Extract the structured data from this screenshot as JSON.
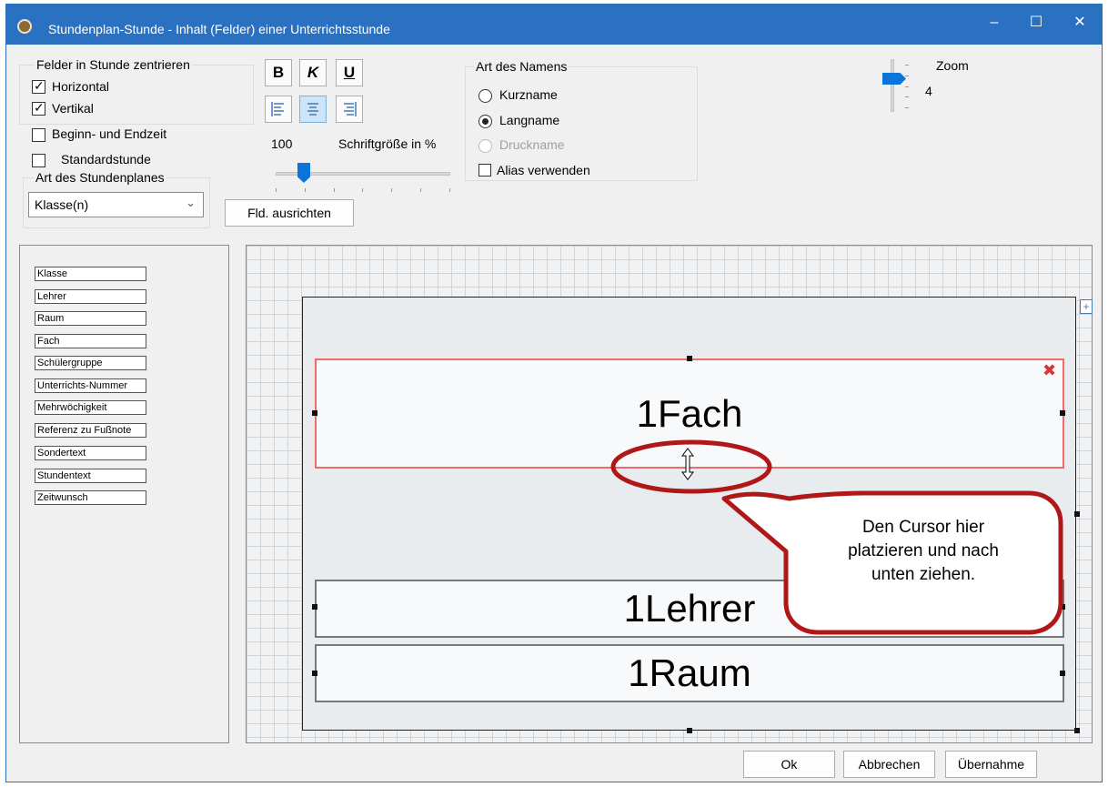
{
  "window": {
    "title": "Stundenplan-Stunde - Inhalt (Felder) einer Unterrichtsstunde",
    "minimize": "‒",
    "maximize": "☐",
    "close": "✕"
  },
  "center_group": {
    "title": "Felder in Stunde zentrieren",
    "horizontal": "Horizontal",
    "vertical": "Vertikal"
  },
  "checkboxes": {
    "times": "Beginn- und Endzeit",
    "standard": "Standardstunde"
  },
  "plan_type": {
    "title": "Art des Stundenplanes",
    "selected": "Klasse(n)"
  },
  "format": {
    "bold": "B",
    "italic": "K",
    "underline": "U",
    "font_size_value": "100",
    "font_size_label": "Schriftgröße in %",
    "font_size_percent": 100,
    "align_button": "Fld. ausrichten"
  },
  "name_type": {
    "title": "Art des Namens",
    "options": [
      "Kurzname",
      "Langname",
      "Druckname"
    ],
    "selected": "Langname",
    "alias": "Alias verwenden"
  },
  "zoom": {
    "label": "Zoom",
    "value": "4"
  },
  "fields": [
    "Klasse",
    "Lehrer",
    "Raum",
    "Fach",
    "Schülergruppe",
    "Unterrichts-Nummer",
    "Mehrwöchigkeit",
    "Referenz zu Fußnote",
    "Sondertext",
    "Stundentext",
    "Zeitwunsch"
  ],
  "lesson_fields": {
    "fach": "1Fach",
    "lehrer": "1Lehrer",
    "raum": "1Raum"
  },
  "callout": {
    "line1": "Den Cursor hier",
    "line2": "platzieren und nach",
    "line3": "unten ziehen."
  },
  "buttons": {
    "ok": "Ok",
    "cancel": "Abbrechen",
    "apply": "Übernahme"
  },
  "colors": {
    "titlebar": "#2b71c2",
    "selected_field": "#ee6b6b",
    "callout_border": "#b01818"
  }
}
